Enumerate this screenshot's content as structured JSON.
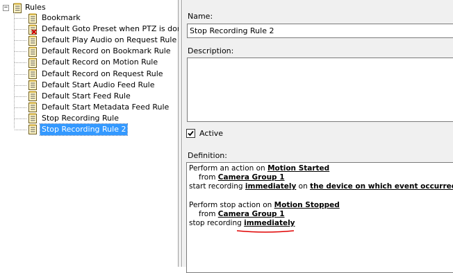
{
  "tree": {
    "root_label": "Rules",
    "items": [
      {
        "label": "Bookmark",
        "error": false,
        "selected": false
      },
      {
        "label": "Default Goto Preset when PTZ is don",
        "error": true,
        "selected": false
      },
      {
        "label": "Default Play Audio on Request Rule",
        "error": false,
        "selected": false
      },
      {
        "label": "Default Record on Bookmark Rule",
        "error": false,
        "selected": false
      },
      {
        "label": "Default Record on Motion Rule",
        "error": false,
        "selected": false
      },
      {
        "label": "Default Record on Request Rule",
        "error": false,
        "selected": false
      },
      {
        "label": "Default Start Audio Feed Rule",
        "error": false,
        "selected": false
      },
      {
        "label": "Default Start Feed Rule",
        "error": false,
        "selected": false
      },
      {
        "label": "Default Start Metadata Feed Rule",
        "error": false,
        "selected": false
      },
      {
        "label": "Stop Recording Rule",
        "error": false,
        "selected": false
      },
      {
        "label": "Stop Recording Rule 2",
        "error": false,
        "selected": true
      }
    ]
  },
  "properties": {
    "name_label": "Name:",
    "name_value": "Stop Recording Rule 2",
    "description_label": "Description:",
    "description_value": "",
    "active_label": "Active",
    "active_checked": true,
    "definition_label": "Definition:",
    "definition": {
      "l1_text": "Perform an action on ",
      "l1_link": "Motion Started",
      "l2_text": "from ",
      "l2_link": "Camera Group 1",
      "l3_text": "start recording ",
      "l3_link1": "immediately",
      "l3_mid": " on ",
      "l3_link2": "the device on which event occurred",
      "l4_text": "Perform stop action on ",
      "l4_link": "Motion Stopped",
      "l5_text": "from ",
      "l5_link": "Camera Group 1",
      "l6_text": "stop recording ",
      "l6_link": "immediately"
    }
  },
  "colors": {
    "selection": "#3399ff",
    "panel_bg": "#f0f0f0",
    "error_mark": "#d40000",
    "squiggle": "#e00000"
  },
  "icons": {
    "root": "rules-folder-icon",
    "item": "rule-document-icon",
    "error_overlay": "error-x-icon",
    "checkbox": "checkmark-icon"
  }
}
